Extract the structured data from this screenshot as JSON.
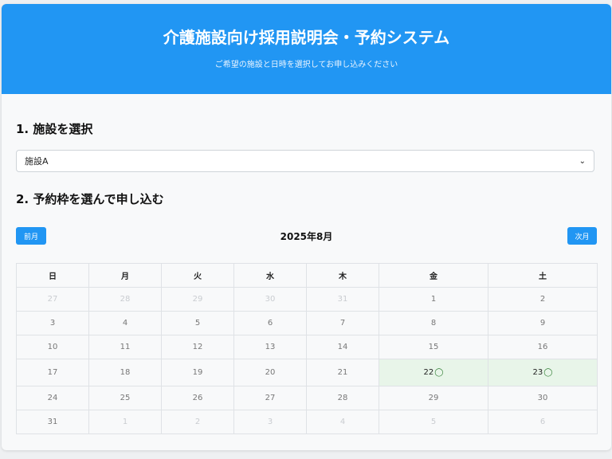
{
  "header": {
    "title": "介護施設向け採用説明会・予約システム",
    "subtitle": "ご希望の施設と日時を選択してお申し込みください"
  },
  "step1": {
    "title": "1. 施設を選択",
    "selected_facility": "施設A"
  },
  "step2": {
    "title": "2. 予約枠を選んで申し込む"
  },
  "calendar": {
    "prev_label": "前月",
    "next_label": "次月",
    "month_label": "2025年8月",
    "weekdays": [
      "日",
      "月",
      "火",
      "水",
      "木",
      "金",
      "土"
    ],
    "weeks": [
      [
        {
          "day": "27",
          "other": true
        },
        {
          "day": "28",
          "other": true
        },
        {
          "day": "29",
          "other": true
        },
        {
          "day": "30",
          "other": true
        },
        {
          "day": "31",
          "other": true
        },
        {
          "day": "1"
        },
        {
          "day": "2"
        }
      ],
      [
        {
          "day": "3"
        },
        {
          "day": "4"
        },
        {
          "day": "5"
        },
        {
          "day": "6"
        },
        {
          "day": "7"
        },
        {
          "day": "8"
        },
        {
          "day": "9"
        }
      ],
      [
        {
          "day": "10"
        },
        {
          "day": "11"
        },
        {
          "day": "12"
        },
        {
          "day": "13"
        },
        {
          "day": "14"
        },
        {
          "day": "15"
        },
        {
          "day": "16"
        }
      ],
      [
        {
          "day": "17"
        },
        {
          "day": "18"
        },
        {
          "day": "19"
        },
        {
          "day": "20"
        },
        {
          "day": "21"
        },
        {
          "day": "22",
          "available": true,
          "mark": "◯"
        },
        {
          "day": "23",
          "available": true,
          "mark": "◯"
        }
      ],
      [
        {
          "day": "24"
        },
        {
          "day": "25"
        },
        {
          "day": "26"
        },
        {
          "day": "27"
        },
        {
          "day": "28"
        },
        {
          "day": "29"
        },
        {
          "day": "30"
        }
      ],
      [
        {
          "day": "31"
        },
        {
          "day": "1",
          "other": true
        },
        {
          "day": "2",
          "other": true
        },
        {
          "day": "3",
          "other": true
        },
        {
          "day": "4",
          "other": true
        },
        {
          "day": "5",
          "other": true
        },
        {
          "day": "6",
          "other": true
        }
      ]
    ]
  },
  "colors": {
    "accent": "#2196f3",
    "available_bg": "#e8f5e9"
  }
}
